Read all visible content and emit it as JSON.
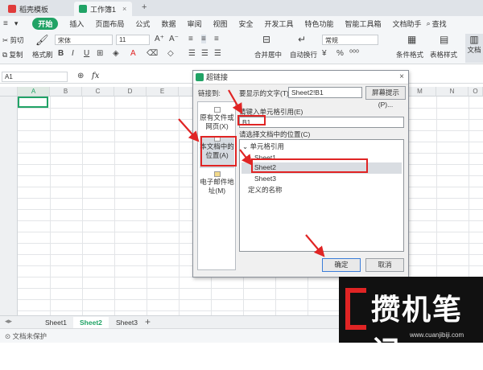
{
  "tabs": [
    {
      "label": "稻壳模板",
      "active": false
    },
    {
      "label": "工作簿1",
      "active": true
    }
  ],
  "menu": {
    "items": [
      "开始",
      "插入",
      "页面布局",
      "公式",
      "数据",
      "审阅",
      "视图",
      "安全",
      "开发工具",
      "特色功能",
      "智能工具箱",
      "文档助手"
    ],
    "search": "查找"
  },
  "ribbon": {
    "cut": "剪切",
    "copy": "复制",
    "format_painter": "格式刷",
    "font": "宋体",
    "font_size": "11",
    "merge_center": "合并居中",
    "wrap_text": "自动换行",
    "number_format": "常规",
    "conditional_format": "条件格式",
    "table_style": "表格样式",
    "doc": "文档"
  },
  "formula_bar": {
    "cell_ref": "A1",
    "fx": "fx"
  },
  "grid": {
    "columns": [
      "A",
      "B",
      "C",
      "D",
      "E",
      "F",
      "G",
      "H",
      "I",
      "J",
      "K",
      "L",
      "M",
      "N",
      "O"
    ]
  },
  "sheets": [
    "Sheet1",
    "Sheet2",
    "Sheet3"
  ],
  "active_sheet": "Sheet2",
  "status": "文档未保护",
  "dialog": {
    "title": "超链接",
    "link_to": "链接到:",
    "display_text_label": "要显示的文字(T):",
    "display_text_value": "Sheet2!B1",
    "screen_tip": "屏幕提示(P)...",
    "nav": [
      {
        "label": "原有文件或网页(X)",
        "icon": "globe-file-icon"
      },
      {
        "label": "本文档中的位置(A)",
        "icon": "document-place-icon"
      },
      {
        "label": "电子邮件地址(M)",
        "icon": "email-icon"
      }
    ],
    "cell_ref_label": "请键入单元格引用(E)",
    "cell_ref_value": "B1",
    "choose_label": "请选择文档中的位置(C)",
    "tree_group": "单元格引用",
    "tree_items": [
      "Sheet1",
      "Sheet2",
      "Sheet3"
    ],
    "defined_names": "定义的名称",
    "ok": "确定",
    "cancel": "取消"
  },
  "watermark": {
    "brand": "攒机笔记",
    "url": "www.cuanjibiji.com"
  },
  "colors": {
    "accent": "#21a366",
    "highlight": "#e02424"
  }
}
